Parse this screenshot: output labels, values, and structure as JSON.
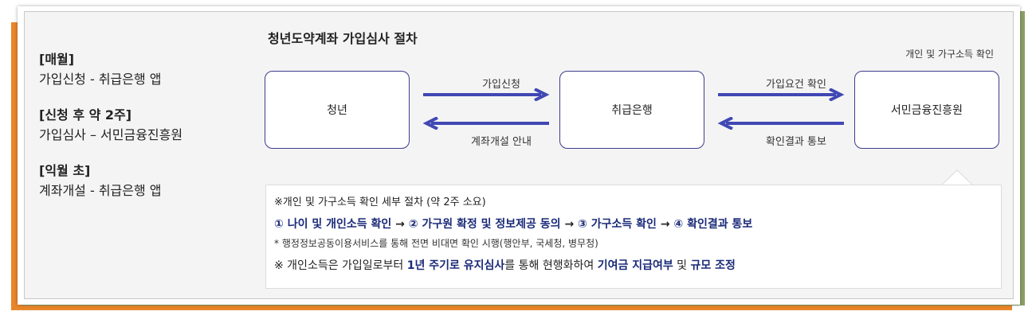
{
  "steps": [
    {
      "title": "[매월]",
      "desc": "가입신청 - 취급은행 앱"
    },
    {
      "title": "[신청 후 약 2주]",
      "desc": "가입심사 – 서민금융진흥원"
    },
    {
      "title": "[익월 초]",
      "desc": "계좌개설 - 취급은행 앱"
    }
  ],
  "diagram": {
    "title": "청년도약계좌 가입심사 절차",
    "top_note": "개인 및 가구소득 확인",
    "nodes": [
      "청년",
      "취급은행",
      "서민금융진흥원"
    ],
    "arrows": {
      "apply": "가입신청",
      "account_notice": "계좌개설 안내",
      "check_requirements": "가입요건 확인",
      "result_notice": "확인결과 통보"
    },
    "arrow_color": "#4048b4"
  },
  "detail": {
    "heading": "※개인 및 가구소득 확인 세부 절차 (약 2주 소요)",
    "flow": [
      "① 나이 및 개인소득 확인",
      "② 가구원 확정 및 정보제공 동의",
      "③ 가구소득 확인",
      "④ 확인결과 통보"
    ],
    "flow_separator": "→",
    "note": "* 행정정보공동이용서비스를 통해 전면 비대면 확인 시행(행안부, 국세청, 병무청)",
    "last": {
      "p1": "※ 개인소득은 가입일로부터 ",
      "b1": "1년 주기로 유지심사",
      "p2": "를 통해 현행화하여 ",
      "b2": "기여금 지급여부",
      "p3": " 및 ",
      "b3": "규모 조정"
    }
  }
}
